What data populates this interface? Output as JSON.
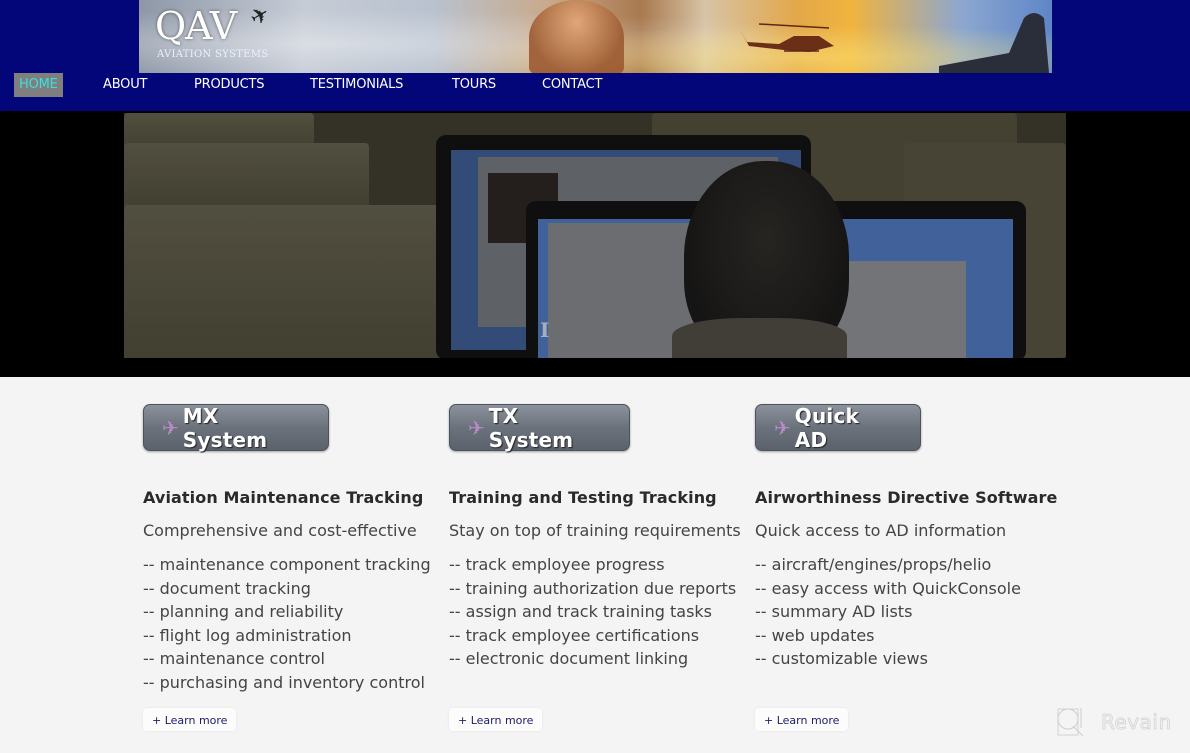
{
  "header": {
    "logo": {
      "title": "QAV",
      "subtitle": "AVIATION SYSTEMS"
    },
    "brand_color": "#020678"
  },
  "nav": {
    "items": [
      {
        "label": "HOME",
        "active": true
      },
      {
        "label": "ABOUT",
        "active": false
      },
      {
        "label": "PRODUCTS",
        "active": false
      },
      {
        "label": "TESTIMONIALS",
        "active": false
      },
      {
        "label": "TOURS",
        "active": false
      },
      {
        "label": "CONTACT",
        "active": false
      }
    ],
    "active_color": "#39e0e0"
  },
  "hero": {
    "caption": "I"
  },
  "products": [
    {
      "button_label": "MX System",
      "icon": "airplane-icon",
      "heading": "Aviation Maintenance Tracking",
      "tagline": "Comprehensive and cost-effective",
      "features": [
        "-- maintenance component tracking",
        "-- document tracking",
        "-- planning and reliability",
        "-- flight log administration",
        "-- maintenance control",
        "-- purchasing and inventory control"
      ],
      "learn_more": "+ Learn more"
    },
    {
      "button_label": "TX System",
      "icon": "airplane-icon",
      "heading": "Training and Testing Tracking",
      "tagline": "Stay on top of training requirements",
      "features": [
        "-- track employee progress",
        "-- training authorization due reports",
        "-- assign and track training tasks",
        "-- track employee certifications",
        "-- electronic document linking"
      ],
      "learn_more": "+ Learn more"
    },
    {
      "button_label": "Quick AD",
      "icon": "airplane-icon",
      "heading": "Airworthiness Directive Software",
      "tagline": "Quick access to AD information",
      "features": [
        "-- aircraft/engines/props/helio",
        "-- easy access with QuickConsole",
        "-- summary AD lists",
        "-- web updates",
        "-- customizable views"
      ],
      "learn_more": "+ Learn more"
    }
  ],
  "watermark": {
    "text": "Revain"
  }
}
